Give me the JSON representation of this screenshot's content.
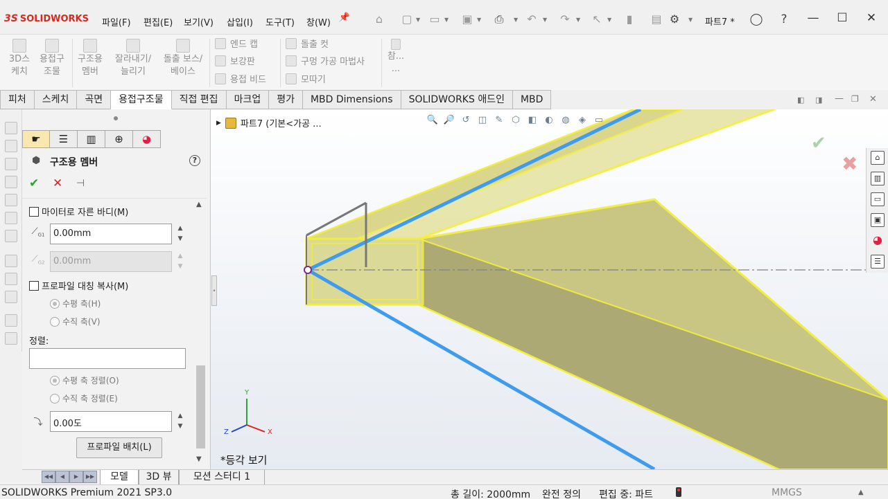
{
  "app": {
    "logo_ds": "3S",
    "logo_name": "SOLIDWORKS",
    "document_title": "파트7 *"
  },
  "menu": [
    "파일(F)",
    "편집(E)",
    "보기(V)",
    "삽입(I)",
    "도구(T)",
    "창(W)"
  ],
  "command_manager": {
    "large_buttons": [
      {
        "label1": "3D스",
        "label2": "케치"
      },
      {
        "label1": "용접구",
        "label2": "조물"
      },
      {
        "label1": "구조용",
        "label2": "멤버"
      },
      {
        "label1": "잘라내기/",
        "label2": "늘리기"
      },
      {
        "label1": "돌출 보스/",
        "label2": "베이스"
      }
    ],
    "small_col1": [
      "엔드 캡",
      "보강판",
      "용접 비드"
    ],
    "small_col2": [
      "돌출 컷",
      "구멍 가공 마법사",
      "모따기"
    ],
    "more": "참...",
    "more2": "..."
  },
  "tabs": [
    {
      "label": "피처",
      "active": false
    },
    {
      "label": "스케치",
      "active": false
    },
    {
      "label": "곡면",
      "active": false
    },
    {
      "label": "용접구조물",
      "active": true
    },
    {
      "label": "직접 편집",
      "active": false
    },
    {
      "label": "마크업",
      "active": false
    },
    {
      "label": "평가",
      "active": false
    },
    {
      "label": "MBD Dimensions",
      "active": false
    },
    {
      "label": "SOLIDWORKS 애드인",
      "active": false
    },
    {
      "label": "MBD",
      "active": false
    }
  ],
  "property_manager": {
    "title": "구조용 멤버",
    "help": "?",
    "ok": "✔",
    "cancel": "✕",
    "pin": "⊣",
    "miter_checkbox": "마이터로 자른 바디(M)",
    "gap1_value": "0.00mm",
    "gap1_sub": "G1",
    "gap2_value": "0.00mm",
    "gap2_sub": "G2",
    "mirror_checkbox": "프로파일 대칭 복사(M)",
    "radio_horizontal": "수평 축(H)",
    "radio_vertical": "수직 축(V)",
    "align_label": "정렬:",
    "align_value": "",
    "radio_align_h": "수평 축 정렬(O)",
    "radio_align_v": "수직 축 정렬(E)",
    "angle_value": "0.00도",
    "locate_button": "프로파일 배치(L)"
  },
  "graphics": {
    "tree_label": "파트7  (기본<가공 ...",
    "view_label": "*등각 보기",
    "triad": {
      "y": "Y",
      "x": "X",
      "z": "Z"
    }
  },
  "bottom_tabs": [
    "모델",
    "3D 뷰",
    "모션 스터디 1"
  ],
  "status_bar": {
    "product": "SOLIDWORKS Premium 2021 SP3.0",
    "length": "총 길이: 2000mm",
    "definition": "완전 정의",
    "editing": "편집 중: 파트",
    "units": "MMGS"
  },
  "colors": {
    "accent_red": "#d52b1e",
    "weld_yellow": "#f2ee3a",
    "path_blue": "#3d9bf0",
    "ok_green": "#2ea12e"
  }
}
